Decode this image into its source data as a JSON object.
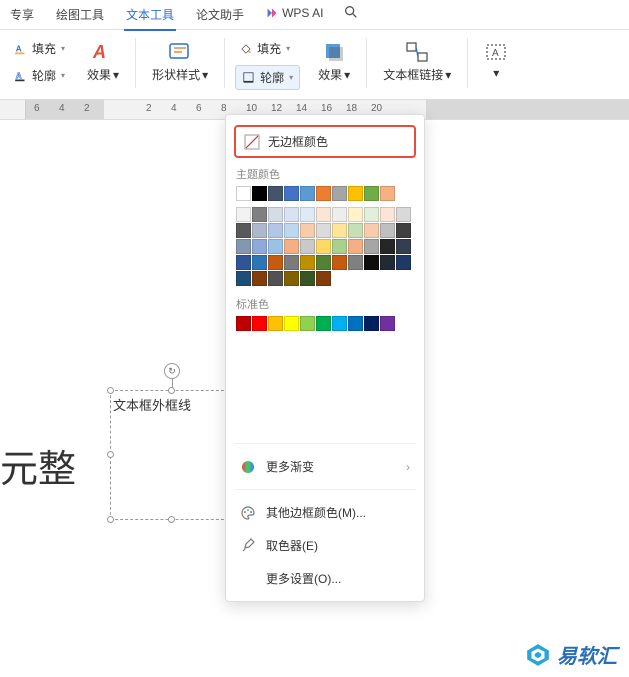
{
  "tabs": {
    "share": "专享",
    "draw": "绘图工具",
    "text": "文本工具",
    "thesis": "论文助手",
    "ai": "WPS AI"
  },
  "toolbar": {
    "fill": "填充",
    "outline": "轮廓",
    "effect": "效果",
    "shapeStyle": "形状样式",
    "fill2": "填充",
    "outline2": "轮廓",
    "effect2": "效果",
    "textboxLink": "文本框链接"
  },
  "ruler": {
    "nums": [
      "6",
      "4",
      "2",
      "2",
      "4",
      "6",
      "8",
      "10",
      "12",
      "14",
      "16",
      "18",
      "20"
    ]
  },
  "doc": {
    "textboxText": "文本框外框线",
    "bodyText": "元整"
  },
  "dropdown": {
    "noBorderColor": "无边框颜色",
    "themeColors": "主题颜色",
    "standardColors": "标准色",
    "moreGradient": "更多渐变",
    "moreBorderColor": "其他边框颜色(M)...",
    "eyedropper": "取色器(E)",
    "moreSettings": "更多设置(O)...",
    "theme_row0": [
      "#ffffff",
      "#000000",
      "#44546a",
      "#4472c4",
      "#5b9bd5",
      "#ed7d31",
      "#a5a5a5",
      "#ffc000",
      "#70ad47",
      "#f4b183"
    ],
    "theme_shades": [
      [
        "#f2f2f2",
        "#808080",
        "#d6dce5",
        "#d9e2f3",
        "#deebf7",
        "#fbe5d6",
        "#ededed",
        "#fff2cc",
        "#e2efda",
        "#fce4d6"
      ],
      [
        "#d9d9d9",
        "#595959",
        "#adb9ca",
        "#b4c6e7",
        "#bdd7ee",
        "#f8cbad",
        "#dbdbdb",
        "#ffe699",
        "#c6e0b4",
        "#f8cbad"
      ],
      [
        "#bfbfbf",
        "#404040",
        "#8497b0",
        "#8eaadb",
        "#9bc2e6",
        "#f4b084",
        "#c9c9c9",
        "#ffd966",
        "#a9d08e",
        "#f4b084"
      ],
      [
        "#a6a6a6",
        "#262626",
        "#333f50",
        "#2f5597",
        "#2e75b6",
        "#c55a11",
        "#7b7b7b",
        "#bf8f00",
        "#548235",
        "#c55a11"
      ],
      [
        "#808080",
        "#0d0d0d",
        "#222a35",
        "#1f3864",
        "#1f4e79",
        "#833c0c",
        "#525252",
        "#806000",
        "#375623",
        "#833c0c"
      ]
    ],
    "standard": [
      "#c00000",
      "#ff0000",
      "#ffc000",
      "#ffff00",
      "#92d050",
      "#00b050",
      "#00b0f0",
      "#0070c0",
      "#002060",
      "#7030a0"
    ]
  },
  "watermark": {
    "text": "易软汇"
  }
}
